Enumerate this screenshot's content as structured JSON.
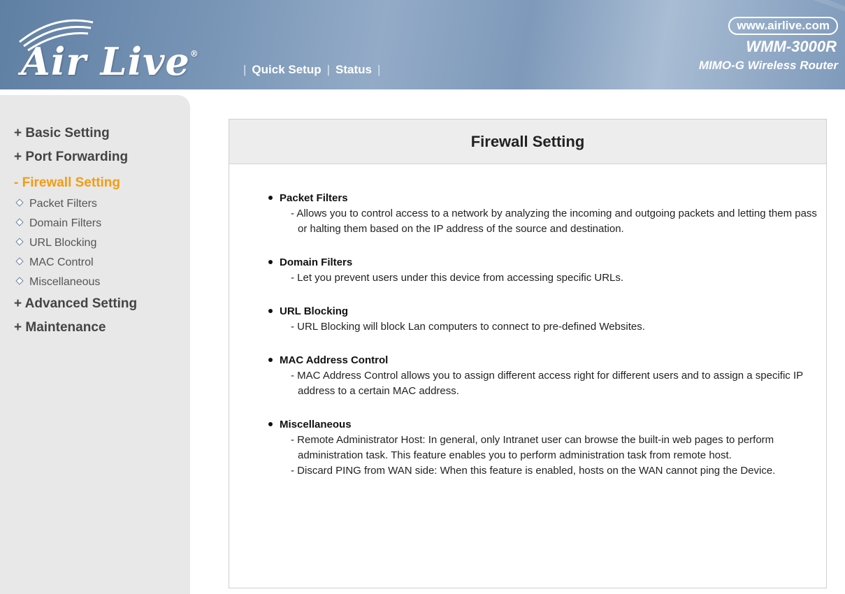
{
  "header": {
    "logo_text": "Air Live",
    "logo_reg": "®",
    "nav": [
      "Quick Setup",
      "Status"
    ],
    "url": "www.airlive.com",
    "model": "WMM-3000R",
    "model_sub": "MIMO-G Wireless Router"
  },
  "sidebar": {
    "items": [
      {
        "label": "+ Basic Setting"
      },
      {
        "label": "+ Port Forwarding"
      },
      {
        "label": "- Firewall Setting",
        "active": true
      },
      {
        "label": "+ Advanced Setting"
      },
      {
        "label": "+ Maintenance"
      }
    ],
    "sub_items": [
      "Packet Filters",
      "Domain Filters",
      "URL Blocking",
      "MAC Control",
      "Miscellaneous"
    ]
  },
  "panel": {
    "title": "Firewall Setting",
    "sections": [
      {
        "title": "Packet Filters",
        "lines": [
          "- Allows you to control access to a network by analyzing the incoming and outgoing packets and letting them pass or halting them based on the IP address of the source and destination."
        ]
      },
      {
        "title": "Domain Filters",
        "lines": [
          "- Let you prevent users under this device from accessing specific URLs."
        ]
      },
      {
        "title": "URL Blocking",
        "lines": [
          "- URL Blocking will block Lan computers to connect to pre-defined Websites."
        ]
      },
      {
        "title": "MAC Address Control",
        "lines": [
          "- MAC Address Control allows you to assign different access right for different users and to assign a specific IP address to a certain MAC address."
        ]
      },
      {
        "title": "Miscellaneous",
        "lines": [
          "- Remote Administrator Host: In general, only Intranet user can browse the built-in web pages to perform administration task. This feature enables you to perform administration task from remote host.",
          "- Discard PING from WAN side: When this feature is enabled, hosts on the WAN cannot ping the Device."
        ]
      }
    ]
  },
  "colors": {
    "header_blue": "#7e99ba",
    "active_menu": "#f39c12",
    "sidebar_bg": "#e8e8e8",
    "panel_head_bg": "#ededed"
  }
}
